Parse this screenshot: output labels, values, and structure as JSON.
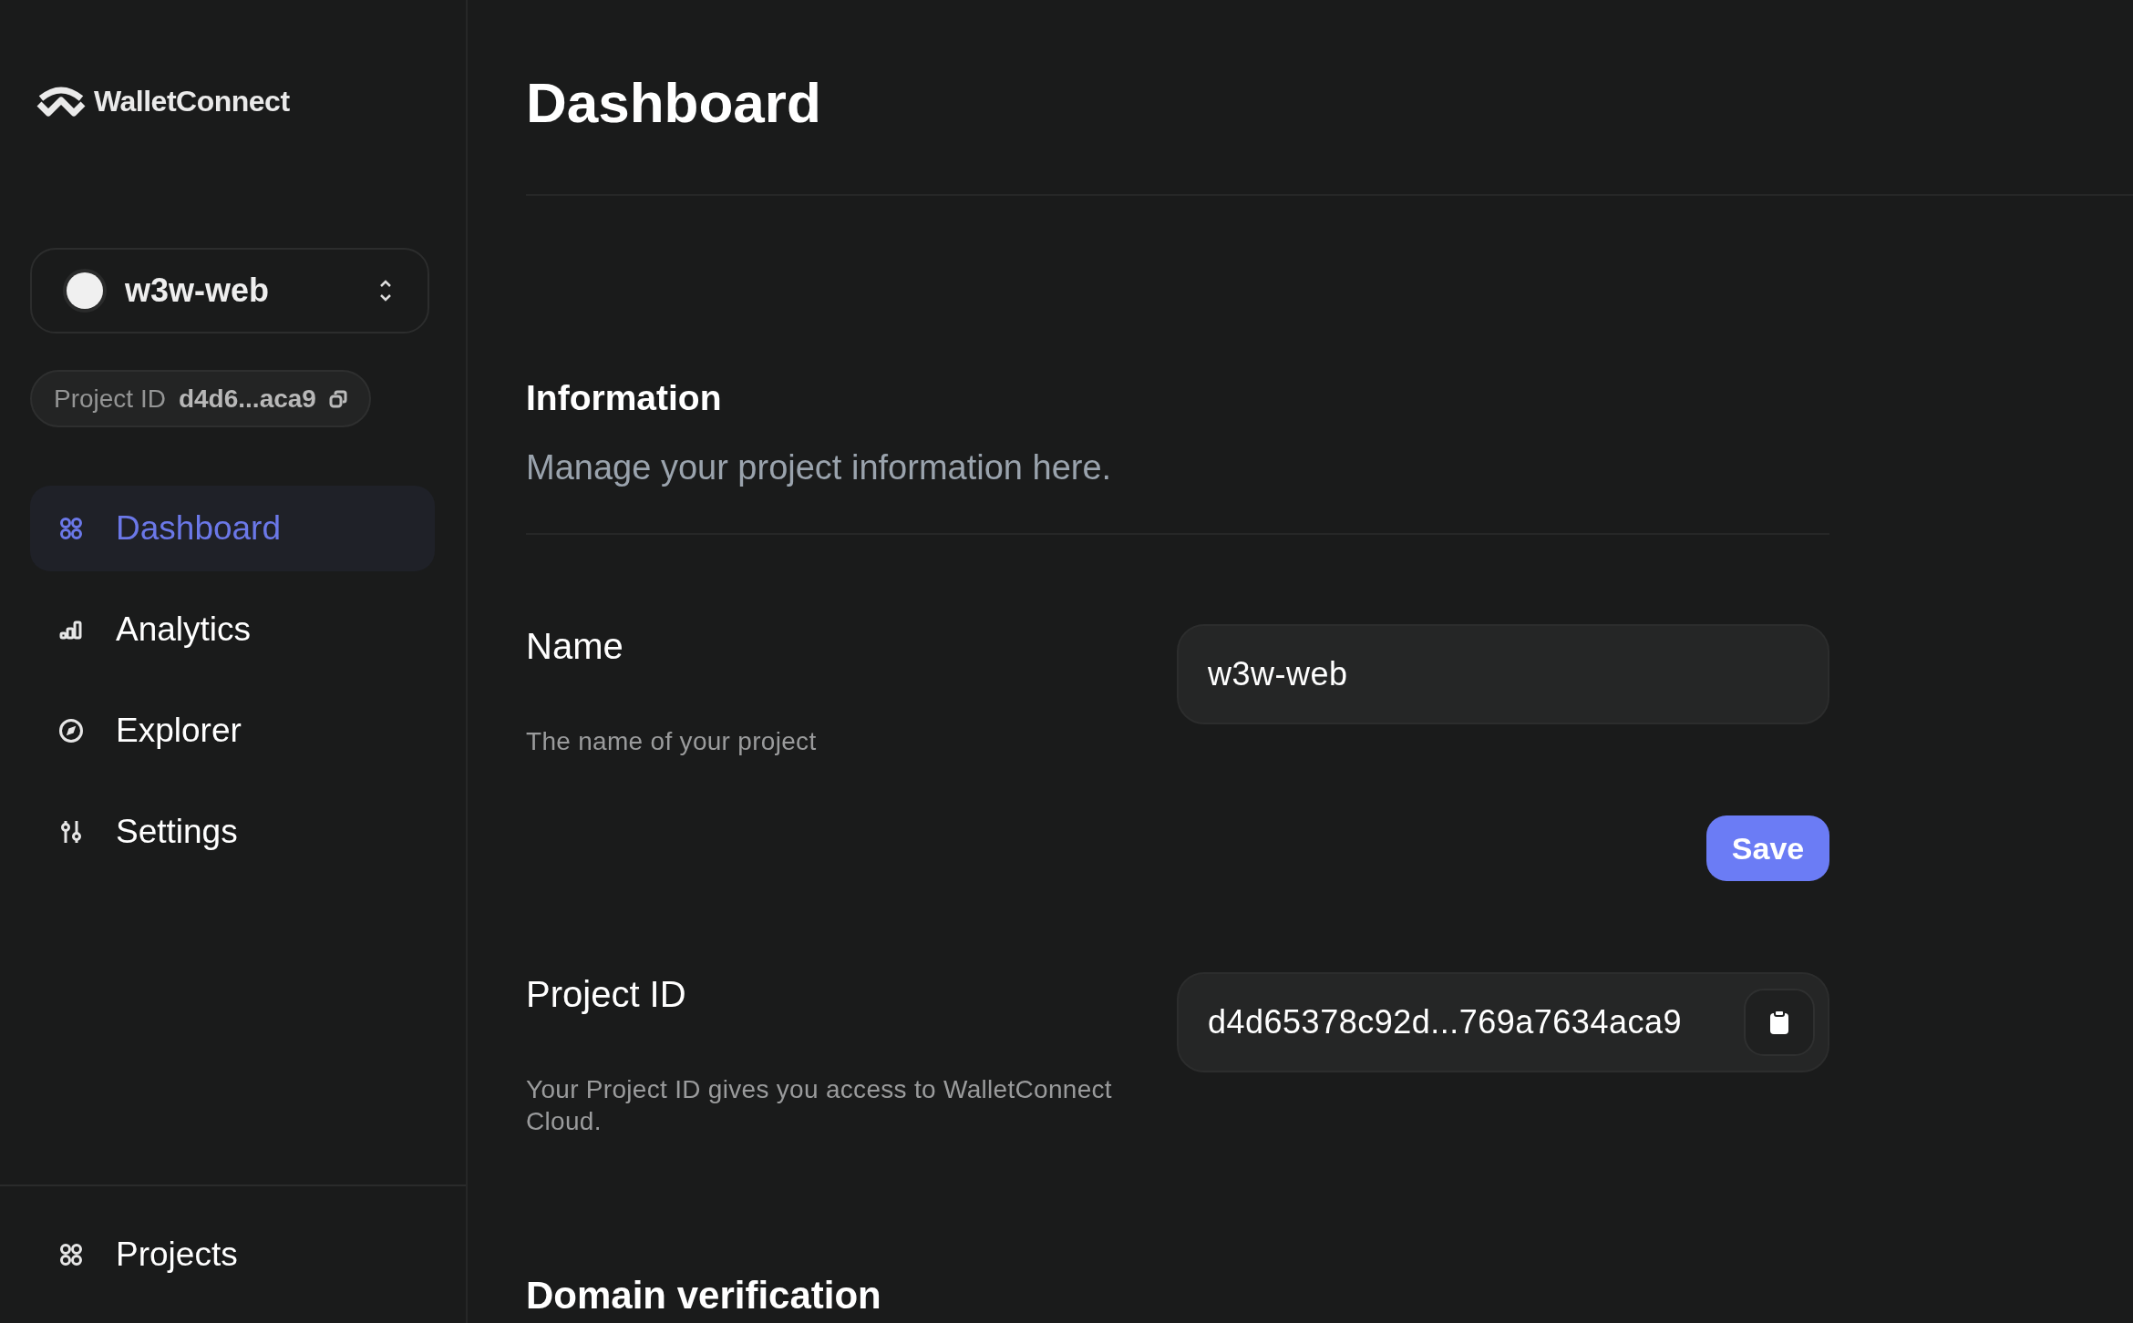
{
  "sidebar": {
    "logo": {
      "text": "WalletConnect"
    },
    "project_selector": {
      "name": "w3w-web"
    },
    "project_id_chip": {
      "label": "Project ID",
      "value": "d4d6...aca9"
    },
    "nav": [
      {
        "label": "Dashboard",
        "kind": "grid",
        "selected": true
      },
      {
        "label": "Analytics",
        "kind": "bars",
        "selected": false
      },
      {
        "label": "Explorer",
        "kind": "compass",
        "selected": false
      },
      {
        "label": "Settings",
        "kind": "sliders",
        "selected": false
      }
    ],
    "footer_item": {
      "label": "Projects",
      "kind": "grid"
    }
  },
  "main": {
    "title": "Dashboard",
    "section": {
      "title": "Information",
      "subtitle": "Manage your project information here."
    },
    "fields": [
      {
        "kind": "text",
        "label": "Name",
        "description": "The name of your project",
        "value": "w3w-web",
        "button": "Save"
      },
      {
        "kind": "copy",
        "label": "Project ID",
        "description": "Your Project ID gives you access to WalletConnect Cloud.",
        "value": "d4d65378c92d...769a7634aca9"
      }
    ],
    "next_section": {
      "title": "Domain verification"
    }
  }
}
